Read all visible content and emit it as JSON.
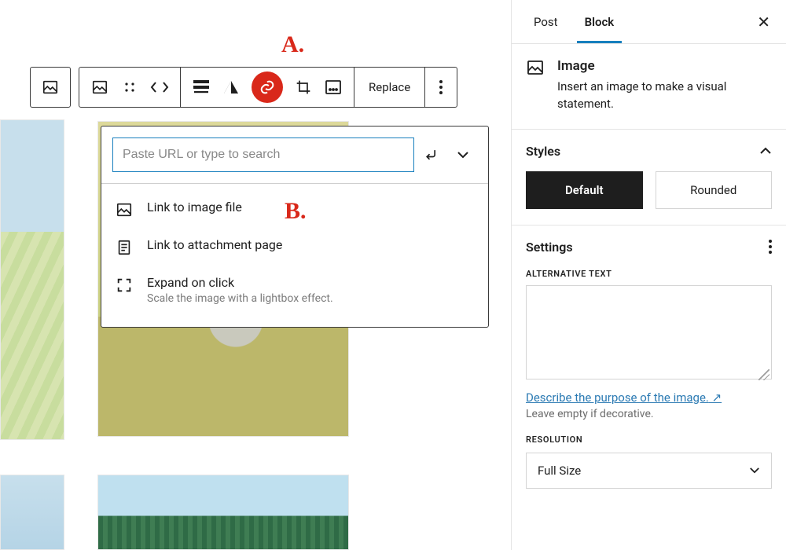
{
  "annotations": {
    "a": "A.",
    "b": "B."
  },
  "toolbar": {
    "replace": "Replace"
  },
  "link_popover": {
    "placeholder": "Paste URL or type to search",
    "options": {
      "image_file": {
        "label": "Link to image file"
      },
      "attachment": {
        "label": "Link to attachment page"
      },
      "expand": {
        "label": "Expand on click",
        "sub": "Scale the image with a lightbox effect."
      }
    }
  },
  "sidebar": {
    "tabs": {
      "post": "Post",
      "block": "Block"
    },
    "block": {
      "title": "Image",
      "desc": "Insert an image to make a visual statement."
    },
    "styles": {
      "heading": "Styles",
      "default": "Default",
      "rounded": "Rounded"
    },
    "settings": {
      "heading": "Settings",
      "alt_label": "ALTERNATIVE TEXT",
      "help_link": "Describe the purpose of the image.",
      "help_hint": "Leave empty if decorative.",
      "resolution_label": "RESOLUTION",
      "resolution_value": "Full Size"
    }
  }
}
